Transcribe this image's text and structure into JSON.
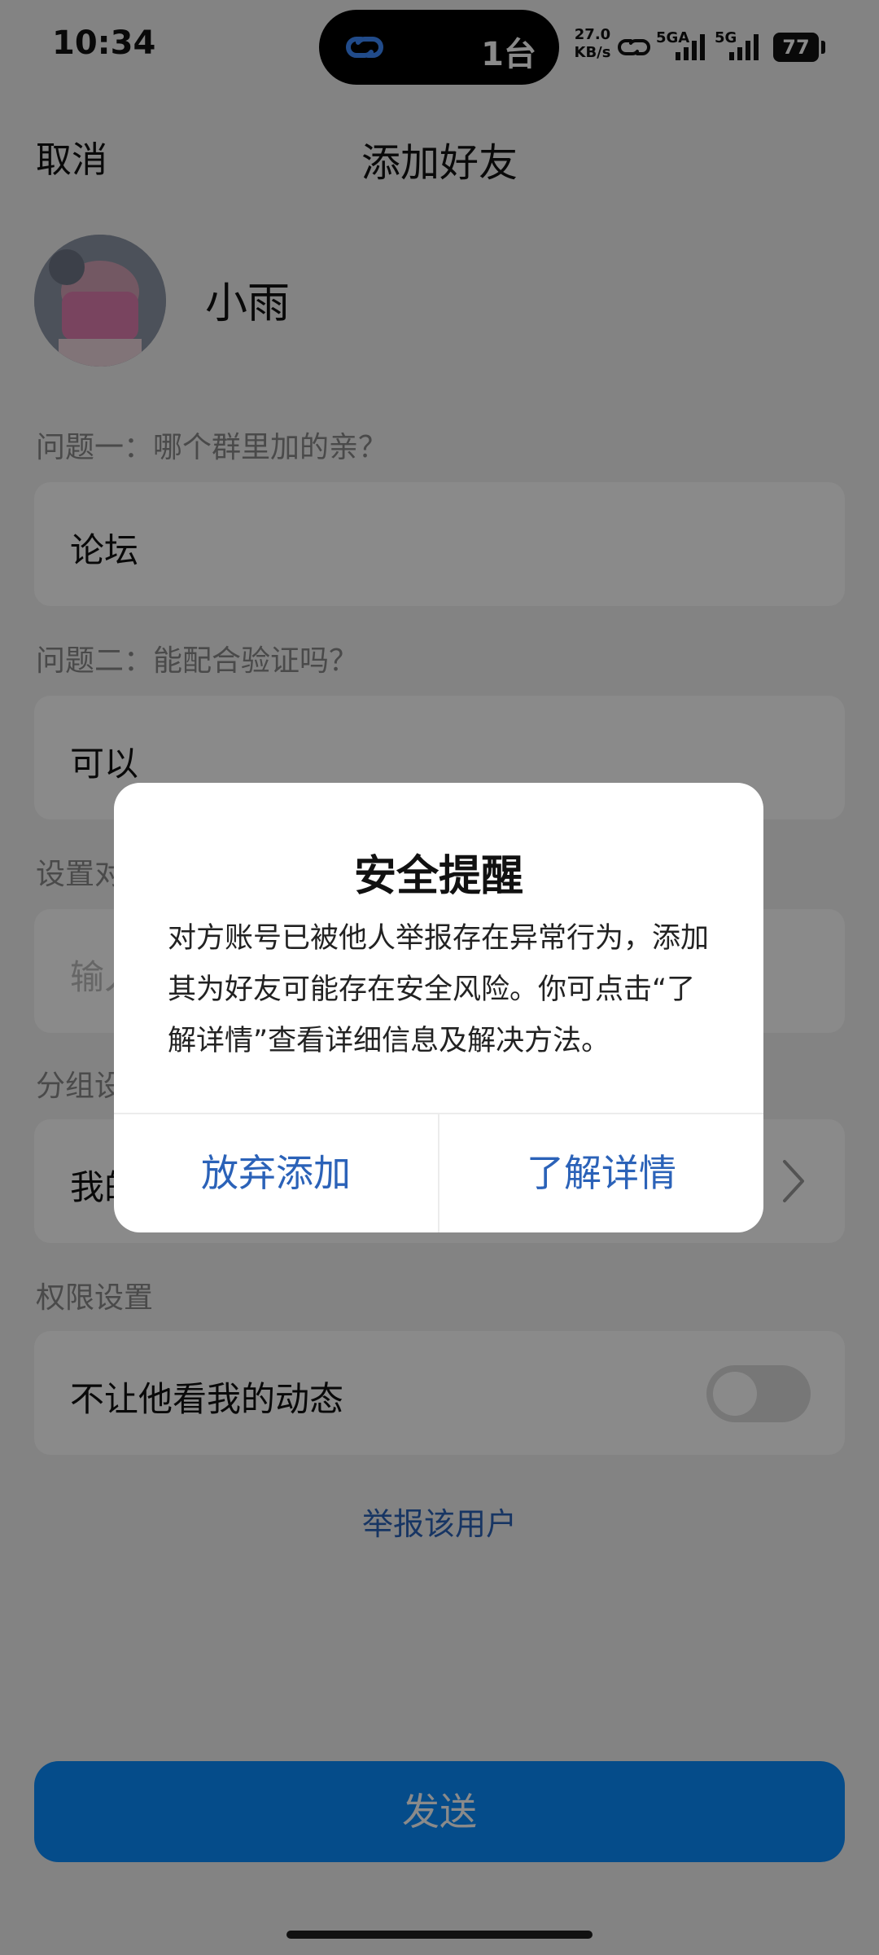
{
  "status_bar": {
    "time": "10:34",
    "island_text": "1台",
    "net_speed_value": "27.0",
    "net_speed_unit": "KB/s",
    "signal1_label": "5GA",
    "signal2_label": "5G",
    "battery": "77"
  },
  "header": {
    "cancel_label": "取消",
    "title": "添加好友"
  },
  "profile": {
    "name": "小雨"
  },
  "form": {
    "question1_label": "问题一：哪个群里加的亲？",
    "question1_answer": "论坛",
    "question2_label": "问题二：能配合验证吗？",
    "question2_answer": "可以",
    "remark_label": "设置对",
    "remark_placeholder": "输入",
    "group_label": "分组设",
    "group_value": "我的",
    "permission_label": "权限设置",
    "hide_moments_label": "不让他看我的动态",
    "hide_moments_on": false
  },
  "report_link": "举报该用户",
  "send_button": "发送",
  "dialog": {
    "title": "安全提醒",
    "message": "对方账号已被他人举报存在异常行为，添加其为好友可能存在安全风险。你可点击“了解详情”查看详细信息及解决方法。",
    "cancel_button": "放弃添加",
    "details_button": "了解详情"
  },
  "colors": {
    "accent": "#2b62b8",
    "send_button": "#0a8cff"
  }
}
